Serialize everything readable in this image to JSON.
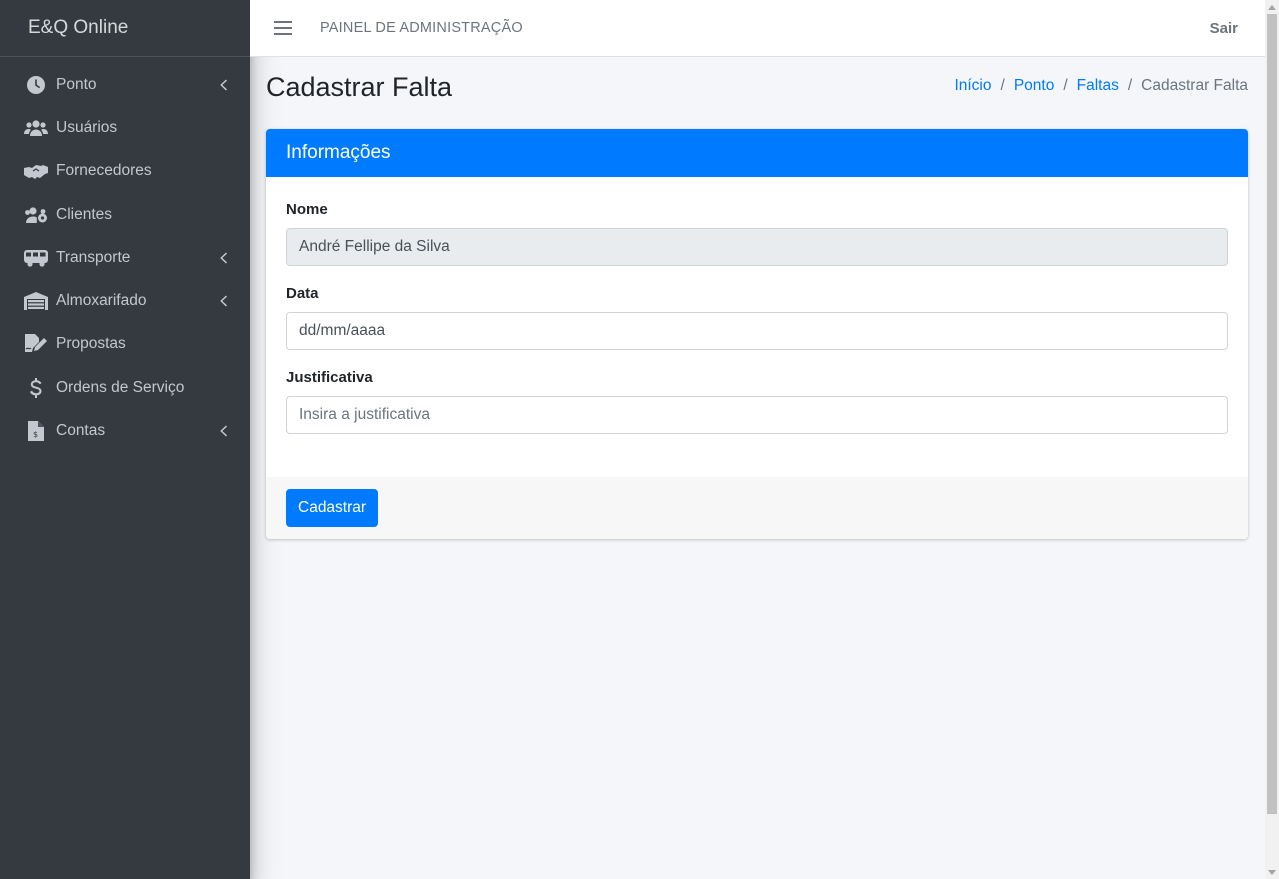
{
  "app": {
    "brand": "E&Q Online"
  },
  "sidebar": {
    "items": [
      {
        "label": "Ponto",
        "icon": "clock-icon",
        "has_children": true
      },
      {
        "label": "Usuários",
        "icon": "users-icon",
        "has_children": false
      },
      {
        "label": "Fornecedores",
        "icon": "handshake-icon",
        "has_children": false
      },
      {
        "label": "Clientes",
        "icon": "users-cog-icon",
        "has_children": false
      },
      {
        "label": "Transporte",
        "icon": "bus-icon",
        "has_children": true
      },
      {
        "label": "Almoxarifado",
        "icon": "warehouse-icon",
        "has_children": true
      },
      {
        "label": "Propostas",
        "icon": "file-signature-icon",
        "has_children": false
      },
      {
        "label": "Ordens de Serviço",
        "icon": "dollar-icon",
        "has_children": false
      },
      {
        "label": "Contas",
        "icon": "invoice-icon",
        "has_children": true
      }
    ]
  },
  "topbar": {
    "panel_label": "PAINEL DE ADMINISTRAÇÃO",
    "logout_label": "Sair"
  },
  "page": {
    "title": "Cadastrar Falta"
  },
  "breadcrumb": {
    "items": [
      "Início",
      "Ponto",
      "Faltas"
    ],
    "active": "Cadastrar Falta",
    "separator": "/"
  },
  "card": {
    "header": "Informações",
    "fields": {
      "nome": {
        "label": "Nome",
        "value": "André Fellipe da Silva"
      },
      "data": {
        "label": "Data",
        "placeholder": "dd/mm/aaaa"
      },
      "justificativa": {
        "label": "Justificativa",
        "placeholder": "Insira a justificativa"
      }
    },
    "submit_label": "Cadastrar"
  },
  "colors": {
    "primary": "#007bff",
    "sidebar_bg": "#343a40",
    "content_bg": "#f4f6f9"
  }
}
